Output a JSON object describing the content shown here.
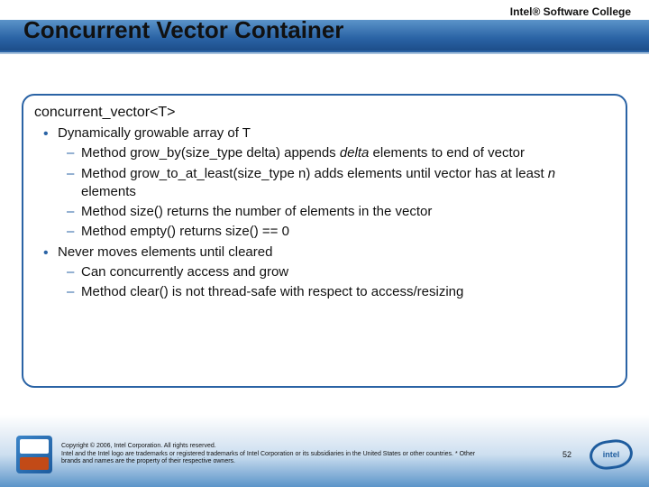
{
  "brand": "Intel® Software College",
  "title": "Concurrent Vector Container",
  "heading": "concurrent_vector<T>",
  "bullets": [
    {
      "text": "Dynamically growable array of T",
      "sub": [
        {
          "pre": "Method grow_by(size_type delta) appends ",
          "em": "delta",
          "post": " elements to end of vector"
        },
        {
          "pre": "Method grow_to_at_least(size_type n) adds elements until vector has at least ",
          "em": "n",
          "post": " elements"
        },
        {
          "pre": "Method size() returns the number of elements in the vector",
          "em": "",
          "post": ""
        },
        {
          "pre": "Method empty() returns size() == 0",
          "em": "",
          "post": ""
        }
      ]
    },
    {
      "text": "Never moves elements until cleared",
      "sub": [
        {
          "pre": "Can concurrently access and grow",
          "em": "",
          "post": ""
        },
        {
          "pre": "Method clear() is not thread-safe with respect to access/resizing",
          "em": "",
          "post": ""
        }
      ]
    }
  ],
  "footer": {
    "copyright_l1": "Copyright © 2006, Intel Corporation. All rights reserved.",
    "copyright_l2": "Intel and the Intel logo are trademarks or registered trademarks of Intel Corporation or its subsidiaries in the United States or other countries. * Other brands and names are the property of their respective owners.",
    "page": "52",
    "logo_text": "intel"
  }
}
